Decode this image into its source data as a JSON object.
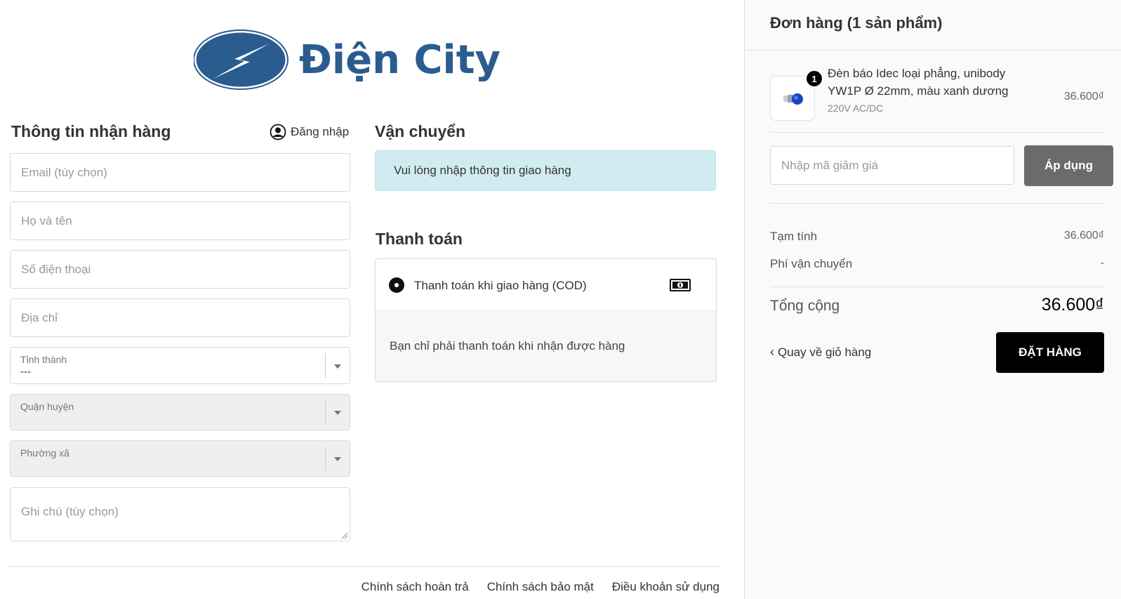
{
  "brand": {
    "name": "Điện City",
    "colors": {
      "primary": "#2a5c8f",
      "alert_bg": "#d1ecf1",
      "button_dark": "#000000",
      "button_gray": "#6b6b6b"
    }
  },
  "receiver": {
    "title": "Thông tin nhận hàng",
    "login_label": "Đăng nhập",
    "email_placeholder": "Email (tùy chọn)",
    "name_placeholder": "Họ và tên",
    "phone_placeholder": "Số điện thoại",
    "address_placeholder": "Địa chỉ",
    "province": {
      "label": "Tỉnh thành",
      "value": "---"
    },
    "district": {
      "label": "Quận huyện"
    },
    "ward": {
      "label": "Phường xã"
    },
    "note_placeholder": "Ghi chú (tùy chọn)"
  },
  "shipping": {
    "title": "Vận chuyển",
    "message": "Vui lòng nhập thông tin giao hàng"
  },
  "payment": {
    "title": "Thanh toán",
    "option_label": "Thanh toán khi giao hàng (COD)",
    "description": "Bạn chỉ phải thanh toán khi nhận được hàng",
    "icon": "cash-icon"
  },
  "footer": {
    "links": [
      "Chính sách hoàn trả",
      "Chính sách bảo mật",
      "Điều khoản sử dụng"
    ]
  },
  "order": {
    "title": "Đơn hàng (1 sản phẩm)",
    "product": {
      "name": "Đèn báo Idec loại phẳng, unibody YW1P Ø 22mm, màu xanh dương",
      "variant": "220V AC/DC",
      "price": "36.600₫",
      "quantity": "1"
    },
    "discount_placeholder": "Nhập mã giảm giá",
    "apply_label": "Áp dụng",
    "subtotal_label": "Tạm tính",
    "subtotal_value": "36.600₫",
    "shipping_fee_label": "Phí vận chuyển",
    "shipping_fee_value": "-",
    "total_label": "Tổng cộng",
    "total_value": "36.600₫",
    "back_label": "Quay về giỏ hàng",
    "place_order_label": "ĐẶT HÀNG"
  }
}
